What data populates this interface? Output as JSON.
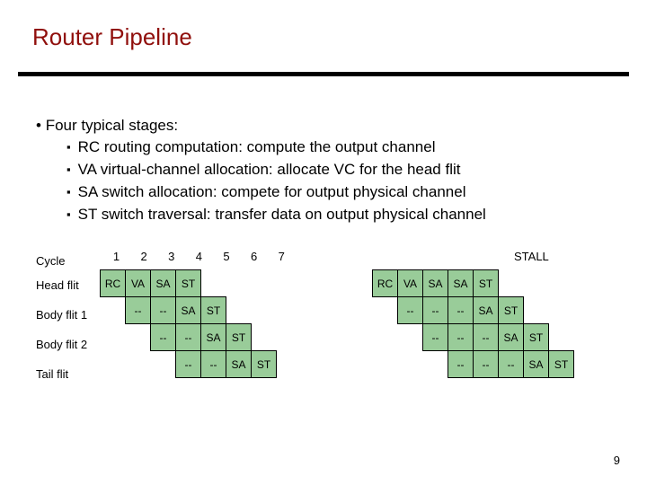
{
  "title": "Router Pipeline",
  "intro": {
    "lead": "Four typical stages:",
    "bullets": [
      "RC routing computation: compute the output channel",
      "VA virtual-channel allocation: allocate VC for the head flit",
      "SA switch allocation: compete for output physical channel",
      "ST switch traversal: transfer data on output physical channel"
    ]
  },
  "cycle_label": "Cycle",
  "cycles": [
    "1",
    "2",
    "3",
    "4",
    "5",
    "6",
    "7"
  ],
  "stall_label": "STALL",
  "rows": [
    {
      "label": "Head flit",
      "cells": [
        "RC",
        "VA",
        "SA",
        "ST"
      ]
    },
    {
      "label": "Body flit 1",
      "cells": [
        "--",
        "--",
        "SA",
        "ST"
      ]
    },
    {
      "label": "Body flit 2",
      "cells": [
        "--",
        "--",
        "SA",
        "ST"
      ]
    },
    {
      "label": "Tail flit",
      "cells": [
        "--",
        "--",
        "SA",
        "ST"
      ]
    }
  ],
  "rows_stall": [
    {
      "cells": [
        "RC",
        "VA",
        "SA",
        "SA",
        "ST"
      ]
    },
    {
      "cells": [
        "--",
        "--",
        "--",
        "SA",
        "ST"
      ]
    },
    {
      "cells": [
        "--",
        "--",
        "--",
        "SA",
        "ST"
      ]
    },
    {
      "cells": [
        "--",
        "--",
        "--",
        "SA",
        "ST"
      ]
    }
  ],
  "page_number": "9"
}
